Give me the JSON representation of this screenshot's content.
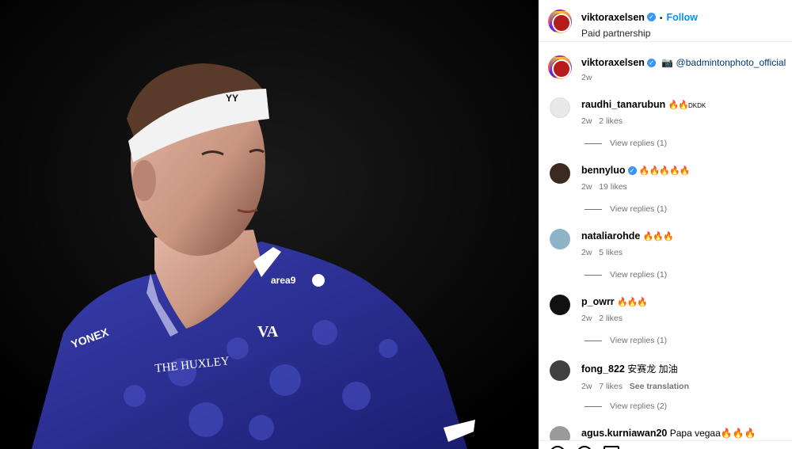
{
  "post": {
    "author": "viktoraxelsen",
    "follow_label": "Follow",
    "subtitle": "Paid partnership",
    "caption_user": "viktoraxelsen",
    "caption_text": "📷 @badmintonphoto_official",
    "caption_time": "2w"
  },
  "photo": {
    "headband_logo": "YONEX",
    "shirt_sponsor_1": "area9",
    "shirt_sponsor_2": "THE HUXLEY",
    "shirt_logo": "VA",
    "shirt_text_left": "YONEX"
  },
  "comments": [
    {
      "user": "raudhi_tanarubun",
      "text": "🔥🔥",
      "suffix": "DKDK",
      "time": "2w",
      "likes": "2 likes",
      "replies": "View replies (1)",
      "verified": false,
      "avatar": "blank"
    },
    {
      "user": "bennyluo",
      "text": "🔥🔥🔥🔥🔥",
      "suffix": "",
      "time": "2w",
      "likes": "19 likes",
      "replies": "View replies (1)",
      "verified": true,
      "avatar": "photo"
    },
    {
      "user": "nataliarohde",
      "text": "🔥🔥🔥",
      "suffix": "",
      "time": "2w",
      "likes": "5 likes",
      "replies": "View replies (1)",
      "verified": false,
      "avatar": "photo"
    },
    {
      "user": "p_owrr",
      "text": "🔥🔥🔥",
      "suffix": "",
      "time": "2w",
      "likes": "2 likes",
      "replies": "View replies (1)",
      "verified": false,
      "avatar": "dark"
    },
    {
      "user": "fong_822",
      "text": "安赛龙 加油",
      "suffix": "",
      "time": "2w",
      "likes": "7 likes",
      "translation": "See translation",
      "replies": "View replies (2)",
      "verified": false,
      "avatar": "photo"
    },
    {
      "user": "agus.kurniawan20",
      "text": "Papa vegaa🔥🔥🔥",
      "suffix": "",
      "time": "",
      "likes": "",
      "replies": "",
      "verified": false,
      "avatar": "photo"
    }
  ],
  "colors": {
    "accent": "#0095f6",
    "verified": "#3897f0",
    "muted": "#737373",
    "jersey": "#2b2f96"
  }
}
